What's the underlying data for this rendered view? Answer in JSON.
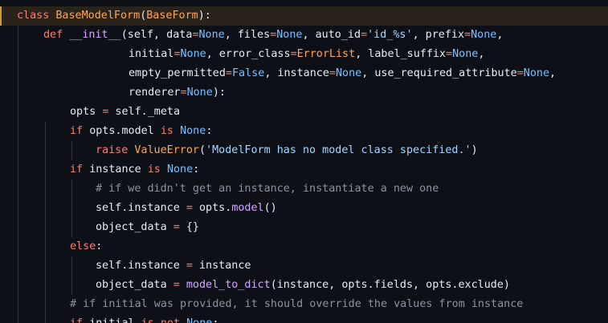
{
  "lines": [
    [
      [
        "kw",
        "class "
      ],
      [
        "cls",
        "BaseModelForm"
      ],
      [
        "pl",
        "("
      ],
      [
        "cls",
        "BaseForm"
      ],
      [
        "pl",
        "):"
      ]
    ],
    [
      [
        "kw",
        "def "
      ],
      [
        "fn",
        "__init__"
      ],
      [
        "pl",
        "(self, data"
      ],
      [
        "op",
        "="
      ],
      [
        "con",
        "None"
      ],
      [
        "pl",
        ", files"
      ],
      [
        "op",
        "="
      ],
      [
        "con",
        "None"
      ],
      [
        "pl",
        ", auto_id"
      ],
      [
        "op",
        "="
      ],
      [
        "str",
        "'id_%s'"
      ],
      [
        "pl",
        ", prefix"
      ],
      [
        "op",
        "="
      ],
      [
        "con",
        "None"
      ],
      [
        "pl",
        ","
      ]
    ],
    [
      [
        "pl",
        "initial"
      ],
      [
        "op",
        "="
      ],
      [
        "con",
        "None"
      ],
      [
        "pl",
        ", error_class"
      ],
      [
        "op",
        "="
      ],
      [
        "cls",
        "ErrorList"
      ],
      [
        "pl",
        ", label_suffix"
      ],
      [
        "op",
        "="
      ],
      [
        "con",
        "None"
      ],
      [
        "pl",
        ","
      ]
    ],
    [
      [
        "pl",
        "empty_permitted"
      ],
      [
        "op",
        "="
      ],
      [
        "con",
        "False"
      ],
      [
        "pl",
        ", instance"
      ],
      [
        "op",
        "="
      ],
      [
        "con",
        "None"
      ],
      [
        "pl",
        ", use_required_attribute"
      ],
      [
        "op",
        "="
      ],
      [
        "con",
        "None"
      ],
      [
        "pl",
        ","
      ]
    ],
    [
      [
        "pl",
        "renderer"
      ],
      [
        "op",
        "="
      ],
      [
        "con",
        "None"
      ],
      [
        "pl",
        "):"
      ]
    ],
    [
      [
        "pl",
        "opts "
      ],
      [
        "op",
        "="
      ],
      [
        "pl",
        " self._meta"
      ]
    ],
    [
      [
        "kw",
        "if "
      ],
      [
        "pl",
        "opts.model "
      ],
      [
        "kw",
        "is "
      ],
      [
        "con",
        "None"
      ],
      [
        "pl",
        ":"
      ]
    ],
    [
      [
        "kw",
        "raise "
      ],
      [
        "cls",
        "ValueError"
      ],
      [
        "pl",
        "("
      ],
      [
        "str",
        "'ModelForm has no model class specified.'"
      ],
      [
        "pl",
        ")"
      ]
    ],
    [
      [
        "kw",
        "if "
      ],
      [
        "pl",
        "instance "
      ],
      [
        "kw",
        "is "
      ],
      [
        "con",
        "None"
      ],
      [
        "pl",
        ":"
      ]
    ],
    [
      [
        "cm",
        "# if we didn't get an instance, instantiate a new one"
      ]
    ],
    [
      [
        "pl",
        "self.instance "
      ],
      [
        "op",
        "="
      ],
      [
        "pl",
        " opts."
      ],
      [
        "fn",
        "model"
      ],
      [
        "pl",
        "()"
      ]
    ],
    [
      [
        "pl",
        "object_data "
      ],
      [
        "op",
        "="
      ],
      [
        "pl",
        " {}"
      ]
    ],
    [
      [
        "kw",
        "else"
      ],
      [
        "pl",
        ":"
      ]
    ],
    [
      [
        "pl",
        "self.instance "
      ],
      [
        "op",
        "="
      ],
      [
        "pl",
        " instance"
      ]
    ],
    [
      [
        "pl",
        "object_data "
      ],
      [
        "op",
        "="
      ],
      [
        "pl",
        " "
      ],
      [
        "fn",
        "model_to_dict"
      ],
      [
        "pl",
        "(instance, opts.fields, opts.exclude)"
      ]
    ],
    [
      [
        "cm",
        "# if initial was provided, it should override the values from instance"
      ]
    ],
    [
      [
        "kw",
        "if "
      ],
      [
        "pl",
        "initial "
      ],
      [
        "kw",
        "is not "
      ],
      [
        "con",
        "None"
      ],
      [
        "pl",
        ":"
      ]
    ]
  ]
}
